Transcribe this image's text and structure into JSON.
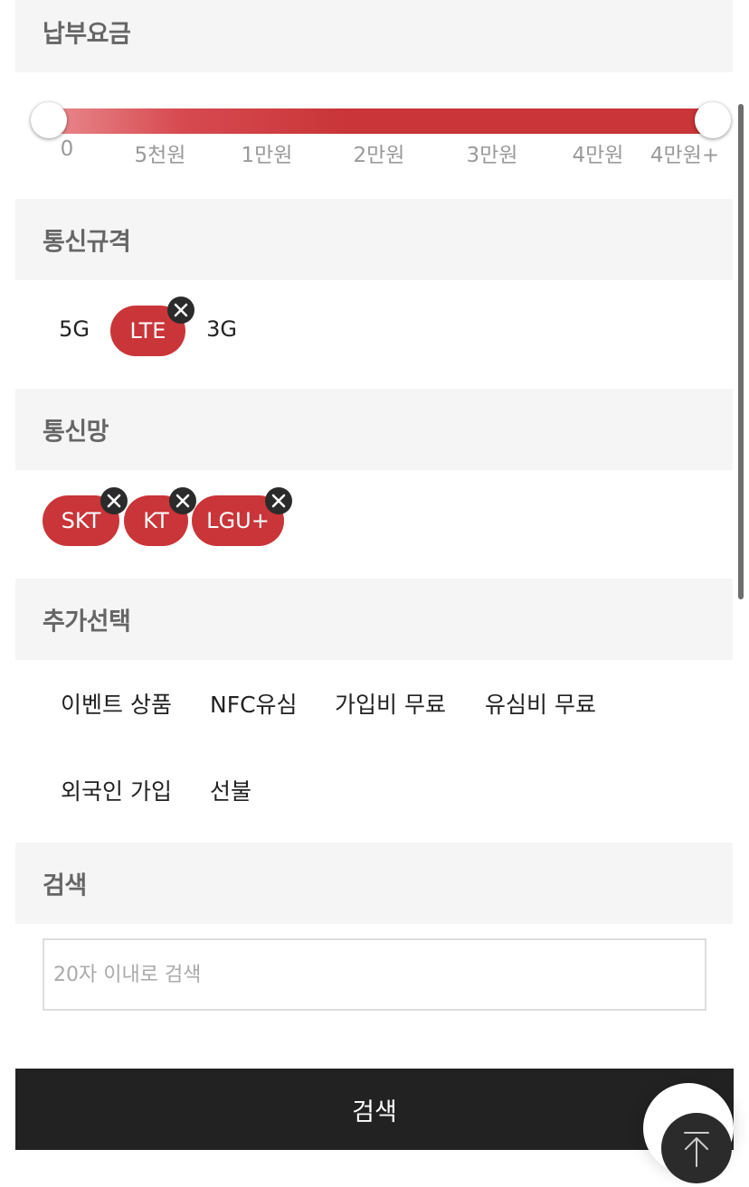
{
  "sections": {
    "fee": {
      "title": "납부요금"
    },
    "network_standard": {
      "title": "통신규격"
    },
    "carrier": {
      "title": "통신망"
    },
    "extras": {
      "title": "추가선택"
    },
    "search": {
      "title": "검색"
    }
  },
  "fee_slider": {
    "ticks": [
      "0",
      "5천원",
      "1만원",
      "2만원",
      "3만원",
      "4만원",
      "4만원+"
    ],
    "selected_min": "0",
    "selected_max": "4만원+",
    "track_color": "#c93538"
  },
  "network_standard_options": [
    {
      "label": "5G",
      "selected": false
    },
    {
      "label": "LTE",
      "selected": true
    },
    {
      "label": "3G",
      "selected": false
    }
  ],
  "carrier_options": [
    {
      "label": "SKT",
      "selected": true
    },
    {
      "label": "KT",
      "selected": true
    },
    {
      "label": "LGU+",
      "selected": true
    }
  ],
  "extra_options": [
    {
      "label": "이벤트 상품",
      "selected": false
    },
    {
      "label": "NFC유심",
      "selected": false
    },
    {
      "label": "가입비 무료",
      "selected": false
    },
    {
      "label": "유심비 무료",
      "selected": false
    },
    {
      "label": "외국인 가입",
      "selected": false
    },
    {
      "label": "선불",
      "selected": false
    }
  ],
  "search_box": {
    "placeholder": "20자 이내로 검색",
    "value": ""
  },
  "search_button": {
    "label": "검색"
  },
  "icons": {
    "remove": "close-circle-icon",
    "scroll_top": "arrow-up-icon"
  },
  "colors": {
    "accent": "#c93538",
    "section_bg": "#f5f5f5",
    "button_bg": "#222222"
  }
}
